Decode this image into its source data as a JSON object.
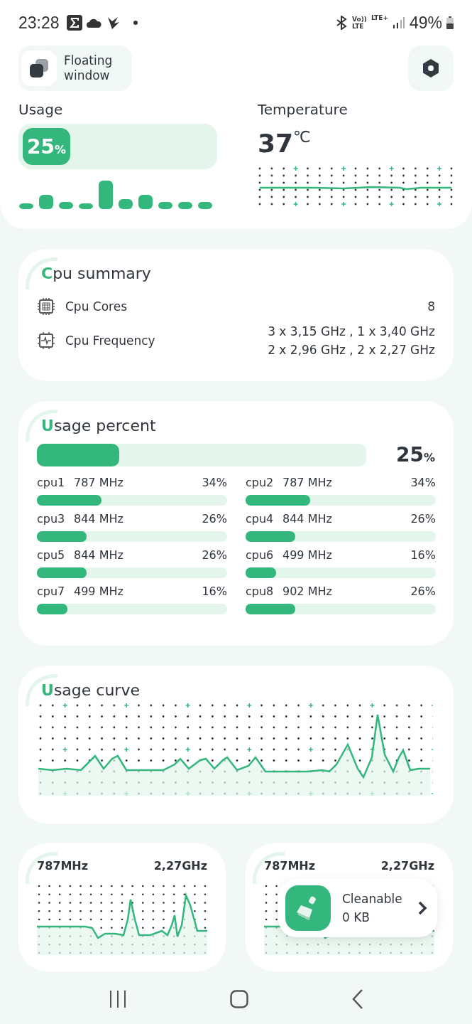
{
  "status_bar": {
    "time": "23:28",
    "volte_top": "Vo))",
    "volte_bottom": "LTE",
    "network": "LTE+",
    "battery": "49%"
  },
  "header": {
    "floating_button": "Floating window"
  },
  "usage": {
    "title": "Usage",
    "value": "25",
    "unit": "%",
    "level": 0.25
  },
  "temperature": {
    "title": "Temperature",
    "value": "37",
    "unit": "℃"
  },
  "cpu_summary": {
    "title": "Cpu summary",
    "rows": [
      {
        "kind": "chip",
        "label": "Cpu Cores",
        "values": [
          "8"
        ]
      },
      {
        "kind": "pulse",
        "label": "Cpu Frequency",
        "values": [
          "3 x 3,15 GHz , 1 x 3,40 GHz",
          "2 x 2,96 GHz , 2 x 2,27 GHz"
        ]
      }
    ]
  },
  "usage_percent": {
    "title": "Usage percent",
    "level": 0.25,
    "value": "25",
    "unit": "%",
    "cores": [
      {
        "name": "cpu1",
        "frequency": "787 MHz",
        "percent": "34%",
        "level": 0.34
      },
      {
        "name": "cpu2",
        "frequency": "787 MHz",
        "percent": "34%",
        "level": 0.34
      },
      {
        "name": "cpu3",
        "frequency": "844 MHz",
        "percent": "26%",
        "level": 0.26
      },
      {
        "name": "cpu4",
        "frequency": "844 MHz",
        "percent": "26%",
        "level": 0.26
      },
      {
        "name": "cpu5",
        "frequency": "844 MHz",
        "percent": "26%",
        "level": 0.26
      },
      {
        "name": "cpu6",
        "frequency": "499 MHz",
        "percent": "16%",
        "level": 0.16
      },
      {
        "name": "cpu7",
        "frequency": "499 MHz",
        "percent": "16%",
        "level": 0.16
      },
      {
        "name": "cpu8",
        "frequency": "902 MHz",
        "percent": "26%",
        "level": 0.26
      }
    ]
  },
  "usage_curve": {
    "title": "Usage curve"
  },
  "frequency_cards": [
    {
      "min": "787MHz",
      "max": "2,27GHz"
    },
    {
      "min": "787MHz",
      "max": "2,27GHz"
    }
  ],
  "cleaner_popup": {
    "title": "Cleanable",
    "value": "0 KB"
  }
}
